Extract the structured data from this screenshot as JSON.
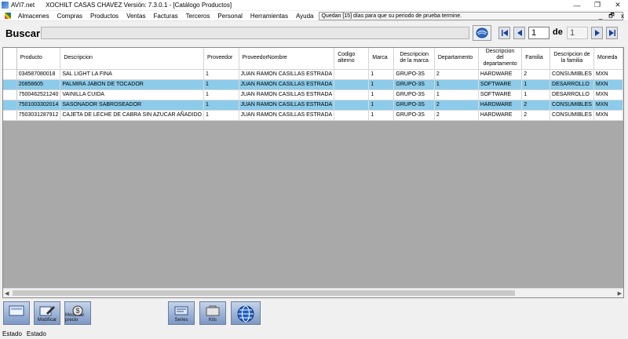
{
  "window": {
    "app_name": "AVI7.net",
    "title": "XOCHILT CASAS CHAVEZ Versión: 7.3.0.1 - [Catálogo Productos]",
    "controls": [
      "—",
      "❐",
      "✕"
    ]
  },
  "menu": {
    "items": [
      "Almacenes",
      "Compras",
      "Productos",
      "Ventas",
      "Facturas",
      "Terceros",
      "Personal",
      "Herramientas",
      "Ayuda"
    ],
    "notice": "Quedan [15] días para que su periodo de prueba termine.",
    "mdi_controls": [
      "_",
      "🗗",
      "x"
    ]
  },
  "search": {
    "label": "Buscar",
    "value": "",
    "current_page": "1",
    "of_label": "de",
    "total_pages": "1"
  },
  "table": {
    "headers": [
      "Producto",
      "Descripcion",
      "Proveedor",
      "ProveedorNombre",
      "Codigo alterno",
      "Marca",
      "Descripcion de la marca",
      "Departamento",
      "Descripcion del departamento",
      "Familia",
      "Descripcion de la familia",
      "Moneda"
    ],
    "rows": [
      [
        "034587080018",
        "SAL LIGHT LA FINA",
        "1",
        "JUAN RAMON CASILLAS ESTRADA",
        "",
        "1",
        "GRUPO-3S",
        "2",
        "HARDWARE",
        "2",
        "CONSUMIBLES",
        "MXN"
      ],
      [
        "20858605",
        "PALMIRA JABON DE TOCADOR",
        "1",
        "JUAN RAMON CASILLAS ESTRADA",
        "",
        "1",
        "GRUPO-3S",
        "1",
        "SOFTWARE",
        "1",
        "DESARROLLO",
        "MXN"
      ],
      [
        "7500462521240",
        "VAINILLA CUIDA",
        "1",
        "JUAN RAMON CASILLAS ESTRADA",
        "",
        "1",
        "GRUPO-3S",
        "1",
        "SOFTWARE",
        "1",
        "DESARROLLO",
        "MXN"
      ],
      [
        "7501003302014",
        "SASONADOR SABROSEADOR",
        "1",
        "JUAN RAMON CASILLAS ESTRADA",
        "",
        "1",
        "GRUPO-3S",
        "2",
        "HARDWARE",
        "2",
        "CONSUMIBLES",
        "MXN"
      ],
      [
        "7503031287912",
        "CAJETA DE LECHE DE CABRA SIN AZUCAR AÑADIDO",
        "1",
        "JUAN RAMON CASILLAS ESTRADA",
        "",
        "1",
        "GRUPO-3S",
        "2",
        "HARDWARE",
        "2",
        "CONSUMIBLES",
        "MXN"
      ]
    ],
    "selected_rows": [
      1,
      3
    ]
  },
  "toolbar": {
    "buttons": [
      {
        "label": "",
        "icon": "new-product-icon"
      },
      {
        "label": "Modificar",
        "icon": "edit-pen-icon"
      },
      {
        "label": "Modificar precio",
        "icon": "price-icon"
      },
      {
        "label": "Series",
        "icon": "series-icon"
      },
      {
        "label": "Kits",
        "icon": "kit-icon"
      },
      {
        "label": "",
        "icon": "globe-icon"
      }
    ]
  },
  "status": {
    "label1": "Estado",
    "label2": "Estado"
  }
}
